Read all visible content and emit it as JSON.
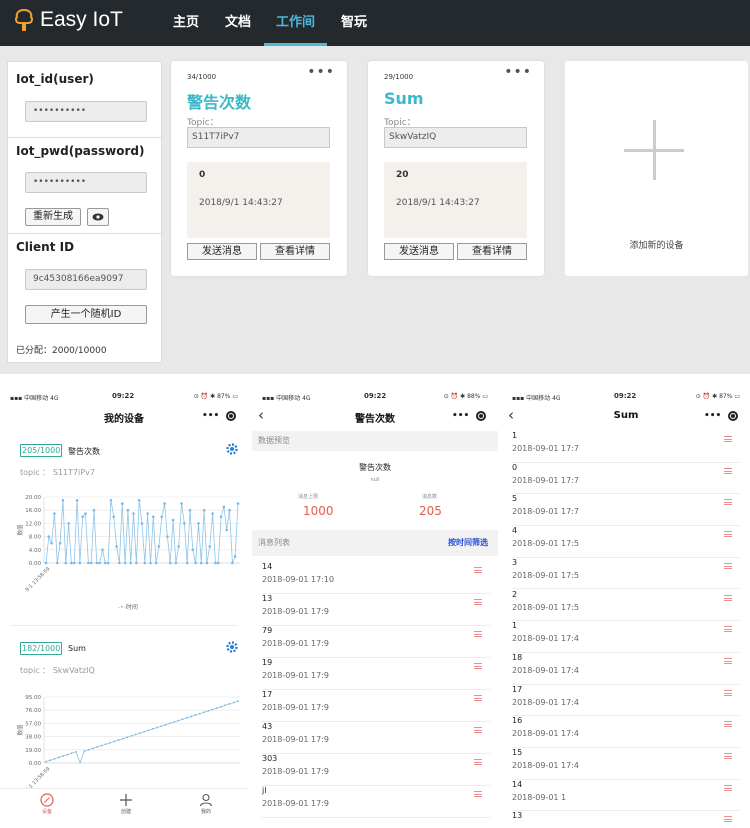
{
  "nav": {
    "logo": "Easy IoT",
    "items": [
      "主页",
      "文档",
      "工作间",
      "智玩"
    ],
    "active_index": 2
  },
  "panel": {
    "user_label": "Iot_id(user)",
    "user_value": "••••••••••",
    "pwd_label": "Iot_pwd(password)",
    "pwd_value": "••••••••••",
    "regen_label": "重新生成",
    "eye_icon": "eye-icon",
    "client_label": "Client ID",
    "client_value": "9c45308166ea9097",
    "random_label": "产生一个随机ID",
    "allocated": "已分配：2000/10000"
  },
  "devices": [
    {
      "count": "34/1000",
      "name": "警告次数",
      "topic_label": "Topic：",
      "topic": "S11T7iPv7",
      "value": "0",
      "time": "2018/9/1 14:43:27",
      "send": "发送消息",
      "detail": "查看详情"
    },
    {
      "count": "29/1000",
      "name": "Sum",
      "topic_label": "Topic：",
      "topic": "SkwVatzIQ",
      "value": "20",
      "time": "2018/9/1 14:43:27",
      "send": "发送消息",
      "detail": "查看详情"
    }
  ],
  "add_device": "添加新的设备",
  "status_bar": {
    "carrier": "中国移动",
    "network": "4G",
    "time": "09:22",
    "battery1": "87%",
    "battery2": "88%",
    "battery3": "87%"
  },
  "phone1": {
    "title": "我的设备",
    "device1": {
      "badge": "205/1000",
      "name": "警告次数",
      "topic": "topic ： S11T7iPv7"
    },
    "device2": {
      "badge": "182/1000",
      "name": "Sum",
      "topic": "topic ： SkwVatzIQ"
    },
    "legend": "时间",
    "ylabel": "数值",
    "tabs": [
      "设备",
      "创建",
      "我的"
    ]
  },
  "phone2": {
    "title": "警告次数",
    "preview_label": "数据预览",
    "device_name": "警告次数",
    "null_text": "null",
    "limit_label": "消息上限",
    "limit_value": "1000",
    "count_label": "消息数",
    "count_value": "205",
    "list_label": "消息列表",
    "filter_label": "按时间筛选",
    "messages": [
      {
        "v": "14",
        "t": "2018-09-01 17:10"
      },
      {
        "v": "13",
        "t": "2018-09-01 17:9"
      },
      {
        "v": "79",
        "t": "2018-09-01 17:9"
      },
      {
        "v": "19",
        "t": "2018-09-01 17:9"
      },
      {
        "v": "17",
        "t": "2018-09-01 17:9"
      },
      {
        "v": "43",
        "t": "2018-09-01 17:9"
      },
      {
        "v": "303",
        "t": "2018-09-01 17:9"
      },
      {
        "v": "jl",
        "t": "2018-09-01 17:9"
      }
    ]
  },
  "phone3": {
    "title": "Sum",
    "messages": [
      {
        "v": "1",
        "t": "2018-09-01 17:7"
      },
      {
        "v": "0",
        "t": "2018-09-01 17:7"
      },
      {
        "v": "5",
        "t": "2018-09-01 17:7"
      },
      {
        "v": "4",
        "t": "2018-09-01 17:5"
      },
      {
        "v": "3",
        "t": "2018-09-01 17:5"
      },
      {
        "v": "2",
        "t": "2018-09-01 17:5"
      },
      {
        "v": "1",
        "t": "2018-09-01 17:4"
      },
      {
        "v": "18",
        "t": "2018-09-01 17:4"
      },
      {
        "v": "17",
        "t": "2018-09-01 17:4"
      },
      {
        "v": "16",
        "t": "2018-09-01 17:4"
      },
      {
        "v": "15",
        "t": "2018-09-01 17:4"
      },
      {
        "v": "14",
        "t": "2018-09-01 1"
      },
      {
        "v": "13",
        "t": ""
      }
    ]
  },
  "chart_data": [
    {
      "type": "line",
      "ylabel": "数值",
      "legend": [
        "时间"
      ],
      "ylim": [
        0,
        20
      ],
      "yticks": [
        0,
        4,
        8,
        12,
        16,
        20
      ],
      "ytick_labels": [
        "0.00",
        "4.00",
        "8.00",
        "12.00",
        "16.00",
        "20.00"
      ],
      "xtick_labels": [
        "9-1 13:58:59"
      ],
      "series": [
        {
          "name": "时间",
          "values": [
            0,
            8,
            6,
            15,
            0,
            6,
            19,
            0,
            12,
            0,
            0,
            19,
            0,
            14,
            15,
            0,
            0,
            16,
            0,
            0,
            4,
            0,
            0,
            19,
            14,
            5,
            0,
            18,
            0,
            16,
            0,
            15,
            0,
            19,
            12,
            0,
            15,
            0,
            14,
            0,
            5,
            14,
            18,
            8,
            0,
            13,
            0,
            5,
            18,
            12,
            0,
            16,
            4,
            0,
            12,
            0,
            16,
            0,
            5,
            15,
            0,
            0,
            14,
            17,
            10,
            16,
            0,
            2,
            18
          ]
        }
      ]
    },
    {
      "type": "line",
      "ylabel": "数值",
      "ylim": [
        0,
        95
      ],
      "yticks": [
        0,
        19,
        38,
        57,
        76,
        95
      ],
      "ytick_labels": [
        "0.00",
        "19.00",
        "38.00",
        "57.00",
        "76.00",
        "95.00"
      ],
      "xtick_labels": [
        "9-1 13:58:59"
      ],
      "series": [
        {
          "name": "",
          "values": [
            2,
            4,
            6,
            8,
            10,
            12,
            14,
            16,
            1,
            17,
            19,
            21,
            23,
            25,
            27,
            29,
            31,
            33,
            35,
            37,
            39,
            41,
            43,
            45,
            47,
            49,
            51,
            53,
            55,
            57,
            59,
            61,
            63,
            65,
            67,
            69,
            71,
            73,
            75,
            77,
            79,
            81,
            83,
            85,
            87,
            89
          ]
        }
      ]
    }
  ]
}
